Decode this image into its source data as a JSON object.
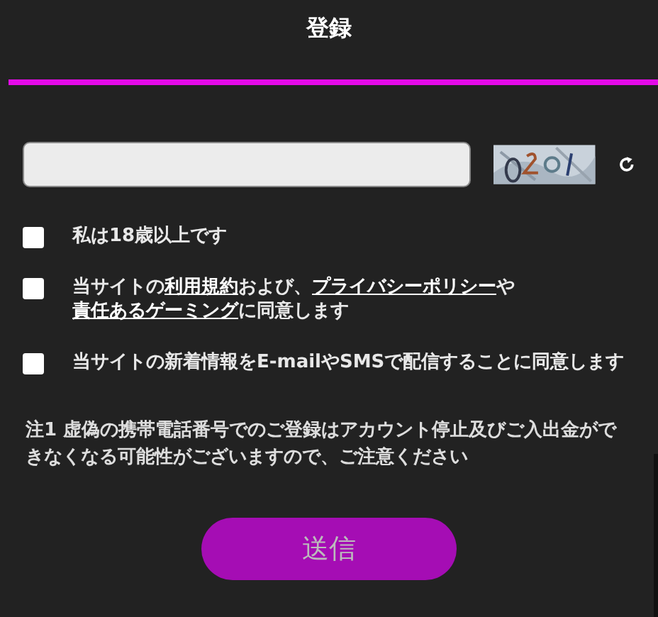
{
  "header": {
    "title": "登録"
  },
  "consents": [
    {
      "checked": false,
      "parts": [
        {
          "kind": "text",
          "text": "私は18歳以上です"
        }
      ]
    },
    {
      "checked": false,
      "parts": [
        {
          "kind": "text",
          "text": "当サイトの"
        },
        {
          "kind": "link",
          "text": "利用規約"
        },
        {
          "kind": "text",
          "text": "および、"
        },
        {
          "kind": "link",
          "text": "プライバシーポリシー"
        },
        {
          "kind": "text",
          "text": "や"
        },
        {
          "kind": "link",
          "text": "責任あるゲーミング"
        },
        {
          "kind": "text",
          "text": "に同意します"
        }
      ]
    },
    {
      "checked": false,
      "parts": [
        {
          "kind": "text",
          "text": "当サイトの新着情報をE-mailやSMSで配信することに同意します"
        }
      ]
    }
  ],
  "note": "注1 虚偽の携帯電話番号でのご登録はアカウント停止及びご入出金ができなくなる可能性がございますので、ご注意ください",
  "submit_button": "送信"
}
